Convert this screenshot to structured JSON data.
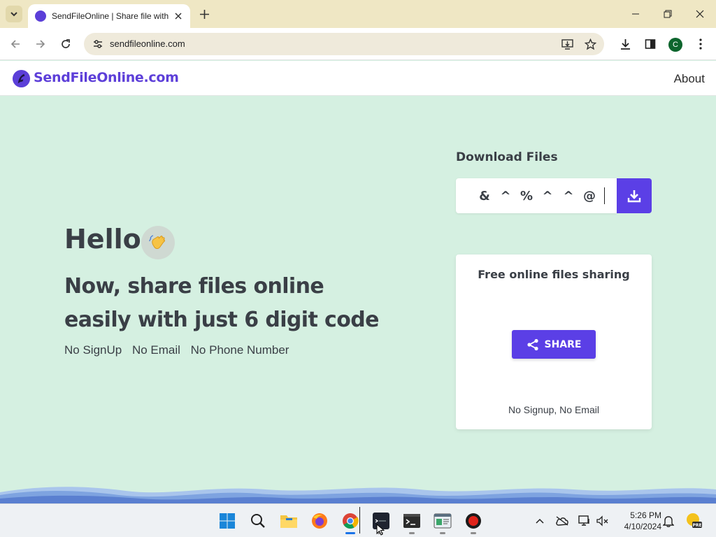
{
  "browser": {
    "tab_title": "SendFileOnline | Share file with",
    "url": "sendfileonline.com",
    "profile_initial": "C"
  },
  "site": {
    "logo_text": "SendFileOnline.com",
    "nav_about": "About",
    "accent_color": "#5b3fe6"
  },
  "hero": {
    "hello": "Hello",
    "headline": "Now, share files online easily with just 6 digit code",
    "features": [
      "No SignUp",
      "No Email",
      "No Phone Number"
    ]
  },
  "download": {
    "title": "Download Files",
    "code_chars": [
      "&",
      "^",
      "%",
      "^",
      "^",
      "@"
    ]
  },
  "share_card": {
    "title": "Free online files sharing",
    "button_label": "SHARE",
    "note": "No Signup, No Email"
  },
  "taskbar": {
    "time": "5:26 PM",
    "date": "4/10/2024"
  }
}
